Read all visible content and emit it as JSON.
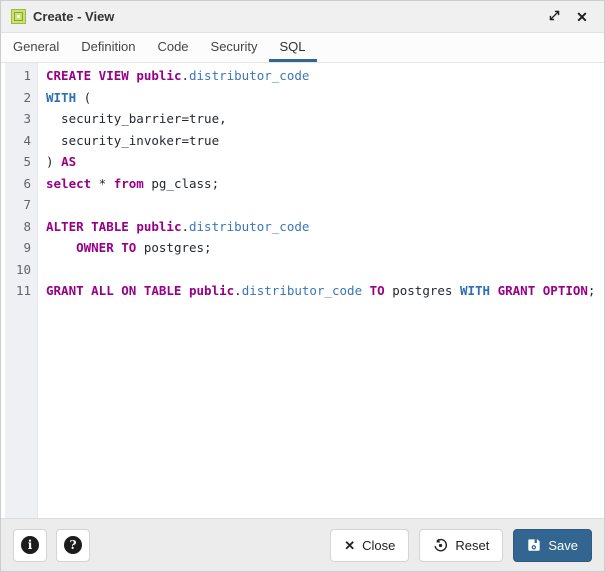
{
  "window": {
    "title": "Create - View",
    "icon": "view-icon",
    "maximize_icon": "maximize-icon",
    "close_icon": "close-icon"
  },
  "tabs": [
    {
      "label": "General",
      "active": false
    },
    {
      "label": "Definition",
      "active": false
    },
    {
      "label": "Code",
      "active": false
    },
    {
      "label": "Security",
      "active": false
    },
    {
      "label": "SQL",
      "active": true
    }
  ],
  "editor": {
    "language": "sql",
    "lines": [
      {
        "no": 1,
        "tokens": [
          {
            "t": "CREATE VIEW ",
            "c": "k"
          },
          {
            "t": "public",
            "c": "k"
          },
          {
            "t": ".",
            "c": "p"
          },
          {
            "t": "distributor_code",
            "c": "v"
          }
        ]
      },
      {
        "no": 2,
        "tokens": [
          {
            "t": "WITH",
            "c": "b"
          },
          {
            "t": " (",
            "c": "p"
          }
        ]
      },
      {
        "no": 3,
        "tokens": [
          {
            "t": "  security_barrier=true,",
            "c": "p"
          }
        ]
      },
      {
        "no": 4,
        "tokens": [
          {
            "t": "  security_invoker=true",
            "c": "p"
          }
        ]
      },
      {
        "no": 5,
        "tokens": [
          {
            "t": ") ",
            "c": "p"
          },
          {
            "t": "AS",
            "c": "k"
          }
        ]
      },
      {
        "no": 6,
        "tokens": [
          {
            "t": "select",
            "c": "k"
          },
          {
            "t": " * ",
            "c": "p"
          },
          {
            "t": "from",
            "c": "k"
          },
          {
            "t": " pg_class;",
            "c": "p"
          }
        ]
      },
      {
        "no": 7,
        "tokens": []
      },
      {
        "no": 8,
        "tokens": [
          {
            "t": "ALTER TABLE ",
            "c": "k"
          },
          {
            "t": "public",
            "c": "k"
          },
          {
            "t": ".",
            "c": "p"
          },
          {
            "t": "distributor_code",
            "c": "v"
          }
        ]
      },
      {
        "no": 9,
        "tokens": [
          {
            "t": "    ",
            "c": "p"
          },
          {
            "t": "OWNER TO",
            "c": "k"
          },
          {
            "t": " postgres;",
            "c": "p"
          }
        ]
      },
      {
        "no": 10,
        "tokens": []
      },
      {
        "no": 11,
        "tokens": [
          {
            "t": "GRANT ALL ON TABLE ",
            "c": "k"
          },
          {
            "t": "public",
            "c": "k"
          },
          {
            "t": ".",
            "c": "p"
          },
          {
            "t": "distributor_code",
            "c": "v"
          },
          {
            "t": " ",
            "c": "p"
          },
          {
            "t": "TO",
            "c": "k"
          },
          {
            "t": " postgres ",
            "c": "p"
          },
          {
            "t": "WITH",
            "c": "b"
          },
          {
            "t": " ",
            "c": "p"
          },
          {
            "t": "GRANT OPTION",
            "c": "k"
          },
          {
            "t": ";",
            "c": "p"
          }
        ]
      }
    ]
  },
  "footer": {
    "info_glyph": "i",
    "help_glyph": "?",
    "close_label": "Close",
    "reset_label": "Reset",
    "save_label": "Save"
  },
  "colors": {
    "accent": "#326690",
    "keyword": "#990088",
    "builtin_blue": "#2c6fb2",
    "identifier_blue": "#3c77b9",
    "titlebar_bg": "#f0f0f0",
    "gutter_bg": "#eef0f3",
    "view_icon_green": "#cbe36a"
  }
}
